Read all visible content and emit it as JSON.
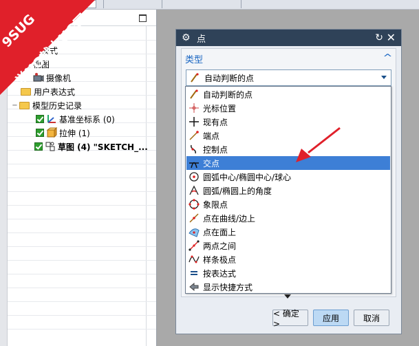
{
  "window": {
    "background": "#a9a9a9"
  },
  "navigator": {
    "items": [
      {
        "label": "录模式",
        "icon": "folder-icon"
      },
      {
        "label": "视图",
        "icon": "folder-icon"
      },
      {
        "label": "摄像机",
        "icon": "camera-icon"
      },
      {
        "label": "用户表达式",
        "icon": "folder-icon"
      },
      {
        "label": "模型历史记录",
        "icon": "folder-icon"
      },
      {
        "label": "基准坐标系 (0)",
        "icon": "datum-csys-icon"
      },
      {
        "label": "拉伸 (1)",
        "icon": "extrude-icon"
      },
      {
        "label": "草图 (4) \"SKETCH_...",
        "icon": "sketch-icon"
      }
    ]
  },
  "watermark": {
    "line1": "9SUG",
    "line2": "学UG就上UG网",
    "color": "#e0202a"
  },
  "dialog": {
    "title": "点",
    "type_section": {
      "label": "类型"
    },
    "type_select": {
      "value": "自动判断的点"
    },
    "buttons": {
      "ok": "< 确定 >",
      "apply": "应用",
      "cancel": "取消"
    }
  },
  "dropdown": {
    "selected_index": 5,
    "items": [
      {
        "label": "自动判断的点",
        "icon": "inferred-point-icon"
      },
      {
        "label": "光标位置",
        "icon": "cursor-location-icon"
      },
      {
        "label": "现有点",
        "icon": "existing-point-icon"
      },
      {
        "label": "端点",
        "icon": "end-point-icon"
      },
      {
        "label": "控制点",
        "icon": "control-point-icon"
      },
      {
        "label": "交点",
        "icon": "intersection-point-icon"
      },
      {
        "label": "圆弧中心/椭圆中心/球心",
        "icon": "arc-center-icon"
      },
      {
        "label": "圆弧/椭圆上的角度",
        "icon": "angle-on-arc-icon"
      },
      {
        "label": "象限点",
        "icon": "quadrant-point-icon"
      },
      {
        "label": "点在曲线/边上",
        "icon": "point-on-curve-icon"
      },
      {
        "label": "点在面上",
        "icon": "point-on-face-icon"
      },
      {
        "label": "两点之间",
        "icon": "between-two-points-icon"
      },
      {
        "label": "样条极点",
        "icon": "spline-pole-icon"
      },
      {
        "label": "按表达式",
        "icon": "by-expression-icon"
      },
      {
        "label": "显示快捷方式",
        "icon": "show-shortcuts-icon"
      }
    ]
  },
  "colors": {
    "title_bar": "#2f4258",
    "accent": "#1a66c2",
    "selection": "#3d7fd6",
    "annotation_arrow": "#e0202a"
  }
}
